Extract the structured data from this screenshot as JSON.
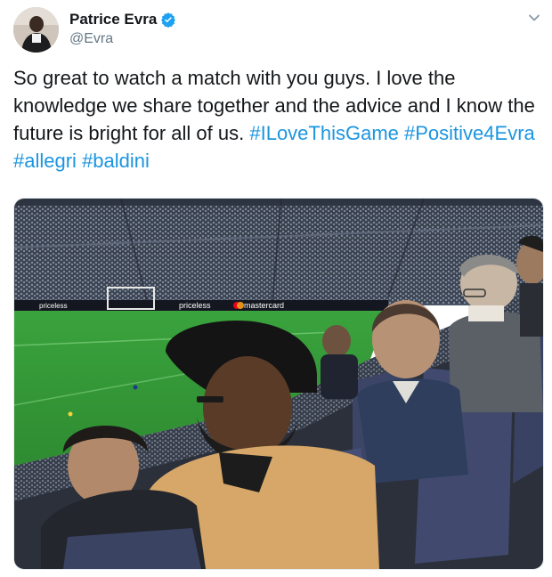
{
  "user": {
    "name": "Patrice Evra",
    "handle": "@Evra",
    "verified": true
  },
  "tweet": {
    "text_plain": "So great to watch a match with you guys. I love the knowledge we share together and the advice and I know the future is bright for all of us.",
    "hashtags": [
      "#ILoveThisGame",
      "#Positive4Evra",
      "#allegri",
      "#baldini"
    ]
  },
  "photo": {
    "boards": [
      "priceless",
      "mastercard",
      "priceless"
    ]
  },
  "icons": {
    "verified": "verified-badge-icon",
    "chevron": "chevron-down-icon"
  },
  "colors": {
    "link": "#1b95e0",
    "verified": "#1da1f2",
    "handle": "#657786",
    "text": "#14171a",
    "pitch": "#3b9d3c"
  }
}
